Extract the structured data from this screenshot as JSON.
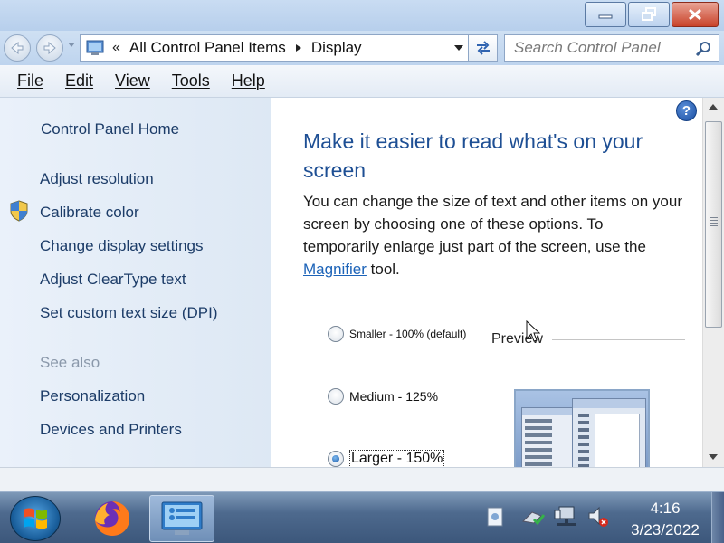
{
  "window": {
    "buttons": {
      "minimize": "minimize",
      "maximize": "restore",
      "close": "close"
    }
  },
  "address_bar": {
    "breadcrumbs": [
      "All Control Panel Items",
      "Display"
    ],
    "search_placeholder": "Search Control Panel"
  },
  "menu": {
    "items": [
      "File",
      "Edit",
      "View",
      "Tools",
      "Help"
    ]
  },
  "left_pane": {
    "home": "Control Panel Home",
    "links": [
      "Adjust resolution",
      "Calibrate color",
      "Change display settings",
      "Adjust ClearType text",
      "Set custom text size (DPI)"
    ],
    "see_also_label": "See also",
    "see_also": [
      "Personalization",
      "Devices and Printers"
    ]
  },
  "content": {
    "heading": "Make it easier to read what's on your screen",
    "description_before": "You can change the size of text and other items on your screen by choosing one of these options. To temporarily enlarge just part of the screen, use the ",
    "description_link": "Magnifier",
    "description_after": " tool.",
    "options": [
      {
        "label": "Smaller - 100% (default)",
        "checked": false
      },
      {
        "label": "Medium - 125%",
        "checked": false
      },
      {
        "label": "Larger - 150%",
        "checked": true
      }
    ],
    "preview_label": "Preview"
  },
  "taskbar": {
    "apps": [
      "firefox-icon",
      "control-panel-icon"
    ],
    "tray_icons": [
      "document-icon",
      "action-center-icon",
      "network-icon",
      "volume-muted-icon"
    ],
    "time": "4:16",
    "date": "3/23/2022"
  },
  "colors": {
    "heading": "#1e4f94",
    "link": "#1c3c68",
    "taskbar": "#4e6a8e"
  }
}
